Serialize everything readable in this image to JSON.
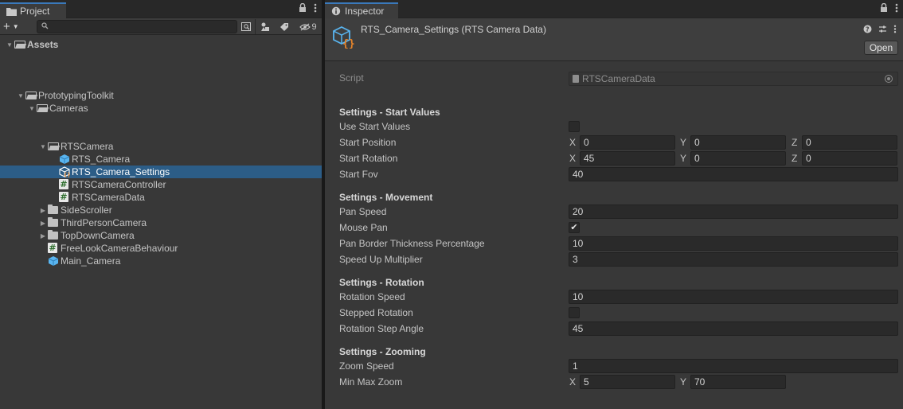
{
  "project": {
    "tab_label": "Project",
    "toolbar": {
      "create_label": "+",
      "search_value": "",
      "hidden_count": "9"
    },
    "tree": [
      {
        "label": "Assets",
        "kind": "folder-open",
        "indent": 0,
        "expanded": true,
        "bold": true
      },
      {
        "label": "PrototypingToolkit",
        "kind": "folder-open",
        "indent": 1,
        "expanded": true
      },
      {
        "label": "Cameras",
        "kind": "folder-open",
        "indent": 2,
        "expanded": true
      },
      {
        "label": "RTSCamera",
        "kind": "folder-open",
        "indent": 3,
        "expanded": true
      },
      {
        "label": "RTS_Camera",
        "kind": "prefab",
        "indent": 4
      },
      {
        "label": "RTS_Camera_Settings",
        "kind": "scriptable",
        "indent": 4,
        "selected": true
      },
      {
        "label": "RTSCameraController",
        "kind": "script",
        "indent": 4
      },
      {
        "label": "RTSCameraData",
        "kind": "script",
        "indent": 4
      },
      {
        "label": "SideScroller",
        "kind": "folder",
        "indent": 3,
        "expanded": false
      },
      {
        "label": "ThirdPersonCamera",
        "kind": "folder",
        "indent": 3,
        "expanded": false
      },
      {
        "label": "TopDownCamera",
        "kind": "folder",
        "indent": 3,
        "expanded": false
      },
      {
        "label": "FreeLookCameraBehaviour",
        "kind": "script",
        "indent": 3
      },
      {
        "label": "Main_Camera",
        "kind": "prefab",
        "indent": 3
      }
    ]
  },
  "inspector": {
    "tab_label": "Inspector",
    "title": "RTS_Camera_Settings (RTS Camera Data)",
    "open_label": "Open",
    "script": {
      "label": "Script",
      "value": "RTSCameraData"
    },
    "sections": {
      "start": {
        "header": "Settings - Start Values",
        "use_start_values": {
          "label": "Use Start Values",
          "checked": false
        },
        "start_position": {
          "label": "Start Position",
          "x": "0",
          "y": "0",
          "z": "0"
        },
        "start_rotation": {
          "label": "Start Rotation",
          "x": "45",
          "y": "0",
          "z": "0"
        },
        "start_fov": {
          "label": "Start Fov",
          "value": "40"
        }
      },
      "movement": {
        "header": "Settings - Movement",
        "pan_speed": {
          "label": "Pan Speed",
          "value": "20"
        },
        "mouse_pan": {
          "label": "Mouse Pan",
          "checked": true
        },
        "pan_border": {
          "label": "Pan Border Thickness Percentage",
          "value": "10"
        },
        "speed_up": {
          "label": "Speed Up Multiplier",
          "value": "3"
        }
      },
      "rotation": {
        "header": "Settings - Rotation",
        "rotation_speed": {
          "label": "Rotation Speed",
          "value": "10"
        },
        "stepped_rotation": {
          "label": "Stepped Rotation",
          "checked": false
        },
        "rotation_step_angle": {
          "label": "Rotation Step Angle",
          "value": "45"
        }
      },
      "zooming": {
        "header": "Settings - Zooming",
        "zoom_speed": {
          "label": "Zoom Speed",
          "value": "1"
        },
        "min_max_zoom": {
          "label": "Min Max Zoom",
          "x": "5",
          "y": "70"
        }
      }
    },
    "axis": {
      "x": "X",
      "y": "Y",
      "z": "Z"
    },
    "check_mark": "✔"
  },
  "colors": {
    "selection": "#2c5d87",
    "tab_accent": "#3a79bb",
    "prefab_blue": "#59b5f0",
    "scriptable_orange": "#e8852a"
  }
}
